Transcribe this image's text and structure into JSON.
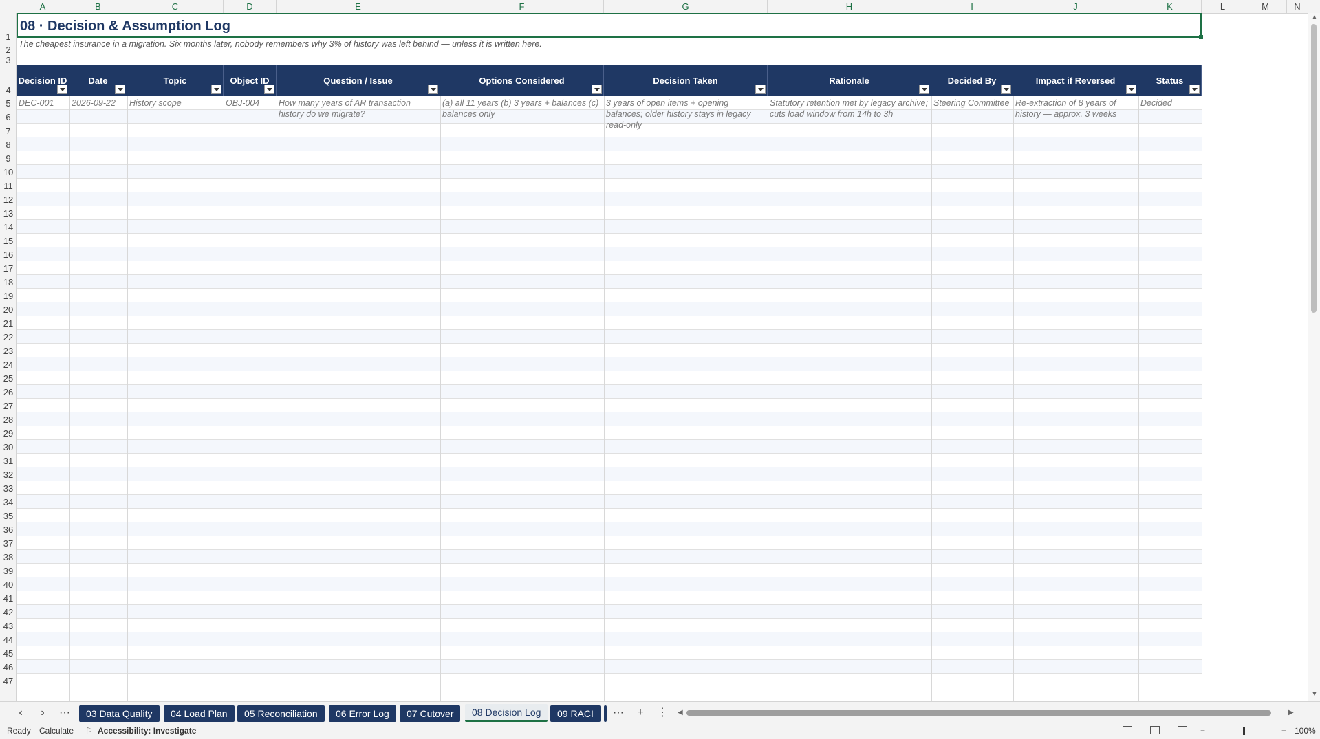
{
  "columns": [
    "A",
    "B",
    "C",
    "D",
    "E",
    "F",
    "G",
    "H",
    "I",
    "J",
    "K",
    "L",
    "M",
    "N"
  ],
  "sheet": {
    "title": "08 · Decision & Assumption Log",
    "subtitle": "The cheapest insurance in a migration. Six months later, nobody remembers why 3% of history was left behind — unless it is written here.",
    "headers": [
      "Decision ID",
      "Date",
      "Topic",
      "Object ID",
      "Question / Issue",
      "Options Considered",
      "Decision Taken",
      "Rationale",
      "Decided By",
      "Impact if Reversed",
      "Status"
    ],
    "row5": [
      "DEC-001",
      "2026-09-22",
      "History scope",
      "OBJ-004",
      "How many years of AR transaction history do we migrate?",
      "(a) all 11 years  (b) 3 years + balances  (c) balances only",
      "3 years of open items + opening balances; older history stays in legacy read-only",
      "Statutory retention met by legacy archive; cuts load window from 14h to 3h",
      "Steering Committee",
      "Re-extraction of 8 years of history — approx. 3 weeks",
      "Decided"
    ]
  },
  "tabs": {
    "items": [
      "03 Data Quality",
      "04 Load Plan",
      "05 Reconciliation",
      "06 Error Log",
      "07 Cutover",
      "08 Decision Log",
      "09 RACI"
    ],
    "active": "08 Decision Log",
    "more": "···",
    "add": "+",
    "options": "⋮"
  },
  "status": {
    "ready": "Ready",
    "calculate": "Calculate",
    "accessibility": "Accessibility: Investigate",
    "zoom": "100%"
  },
  "colors": {
    "header_bg": "#1f3864",
    "accent": "#1e7145"
  }
}
